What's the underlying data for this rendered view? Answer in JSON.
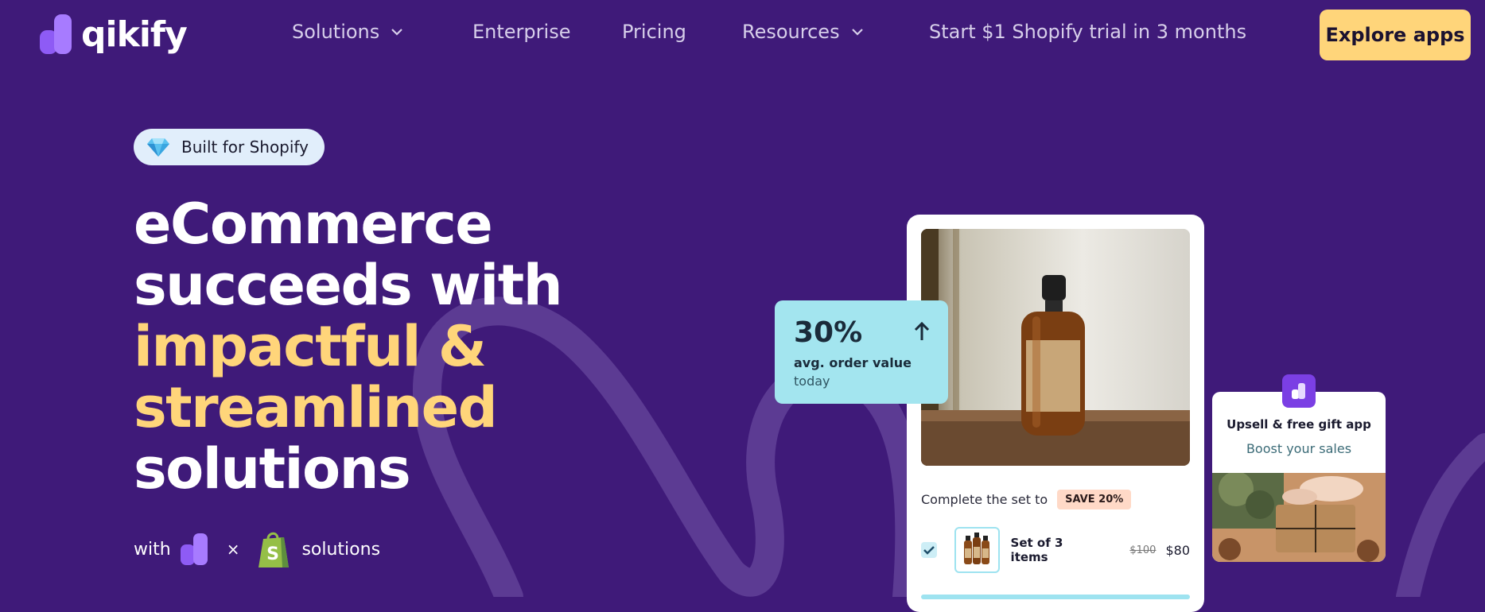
{
  "brand": {
    "name": "qikify"
  },
  "nav": {
    "items": [
      {
        "label": "Solutions",
        "has_dropdown": true
      },
      {
        "label": "Enterprise",
        "has_dropdown": false
      },
      {
        "label": "Pricing",
        "has_dropdown": false
      },
      {
        "label": "Resources",
        "has_dropdown": true
      },
      {
        "label": "Start $1 Shopify trial in 3 months",
        "has_dropdown": false
      }
    ],
    "cta_label": "Explore apps"
  },
  "hero": {
    "badge": "Built for Shopify",
    "title_lines": [
      {
        "text": "eCommerce",
        "color": "white"
      },
      {
        "text": "succeeds with",
        "color": "white"
      },
      {
        "text": "impactful &",
        "color": "yellow"
      },
      {
        "text": "streamlined",
        "color": "yellow"
      },
      {
        "text": "solutions",
        "color": "white"
      }
    ],
    "with_label": "with",
    "times_symbol": "×",
    "solutions_label": "solutions"
  },
  "stat_card": {
    "value": "30%",
    "label": "avg. order value",
    "sub": "today",
    "icon": "arrow-up-icon"
  },
  "product_card": {
    "complete_label": "Complete the set to",
    "save_badge": "SAVE 20%",
    "set_label": "Set of 3  items",
    "old_price": "$100",
    "new_price": "$80",
    "checked": true
  },
  "gift_card": {
    "title": "Upsell & free gift app",
    "subtitle": "Boost your sales"
  },
  "colors": {
    "background": "#3F1A79",
    "accent_yellow": "#FFD57A",
    "stat_card": "#A3E5EF",
    "brand_purple": "#7B3FE4",
    "shopify_green": "#95BF47"
  }
}
